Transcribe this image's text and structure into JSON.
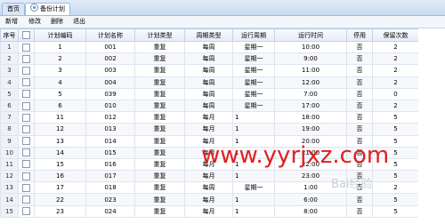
{
  "tabs": [
    {
      "label": "首页"
    },
    {
      "label": "备份计划"
    }
  ],
  "toolbar": {
    "add": "新增",
    "edit": "修改",
    "delete": "删除",
    "exit": "退出"
  },
  "columns": {
    "rownum": "序号",
    "code": "计划编码",
    "name": "计划名称",
    "type": "计划类型",
    "cycle_type": "周期类型",
    "cycle": "运行周期",
    "time": "运行时间",
    "disabled": "停用",
    "keep": "保留次数"
  },
  "rows": [
    {
      "n": "1",
      "code": "1",
      "name": "001",
      "type": "重复",
      "cycle_type": "每周",
      "cycle": "星期一",
      "time": "10:00",
      "disabled": "否",
      "keep": "2"
    },
    {
      "n": "2",
      "code": "2",
      "name": "002",
      "type": "重复",
      "cycle_type": "每周",
      "cycle": "星期一",
      "time": "9:00",
      "disabled": "否",
      "keep": "2"
    },
    {
      "n": "3",
      "code": "3",
      "name": "003",
      "type": "重复",
      "cycle_type": "每周",
      "cycle": "星期一",
      "time": "11:00",
      "disabled": "否",
      "keep": "2"
    },
    {
      "n": "4",
      "code": "4",
      "name": "004",
      "type": "重复",
      "cycle_type": "每周",
      "cycle": "星期一",
      "time": "12:00",
      "disabled": "否",
      "keep": "2"
    },
    {
      "n": "5",
      "code": "5",
      "name": "039",
      "type": "重复",
      "cycle_type": "每周",
      "cycle": "星期一",
      "time": "7:00",
      "disabled": "否",
      "keep": "0"
    },
    {
      "n": "6",
      "code": "6",
      "name": "010",
      "type": "重复",
      "cycle_type": "每周",
      "cycle": "星期一",
      "time": "17:00",
      "disabled": "否",
      "keep": "2"
    },
    {
      "n": "7",
      "code": "11",
      "name": "012",
      "type": "重复",
      "cycle_type": "每月",
      "cycle": "1",
      "time": "18:00",
      "disabled": "否",
      "keep": "5"
    },
    {
      "n": "8",
      "code": "12",
      "name": "013",
      "type": "重复",
      "cycle_type": "每月",
      "cycle": "1",
      "time": "19:00",
      "disabled": "否",
      "keep": "5"
    },
    {
      "n": "9",
      "code": "13",
      "name": "014",
      "type": "重复",
      "cycle_type": "每月",
      "cycle": "1",
      "time": "20:00",
      "disabled": "否",
      "keep": "5"
    },
    {
      "n": "10",
      "code": "14",
      "name": "015",
      "type": "重复",
      "cycle_type": "每月",
      "cycle": "1",
      "time": "21:00",
      "disabled": "否",
      "keep": "5"
    },
    {
      "n": "11",
      "code": "15",
      "name": "016",
      "type": "重复",
      "cycle_type": "每月",
      "cycle": "1",
      "time": "22:00",
      "disabled": "否",
      "keep": "5"
    },
    {
      "n": "12",
      "code": "16",
      "name": "017",
      "type": "重复",
      "cycle_type": "每月",
      "cycle": "1",
      "time": "23:00",
      "disabled": "否",
      "keep": "5"
    },
    {
      "n": "13",
      "code": "17",
      "name": "018",
      "type": "重复",
      "cycle_type": "每周",
      "cycle": "星期一",
      "time": "1:00",
      "disabled": "否",
      "keep": "2"
    },
    {
      "n": "14",
      "code": "22",
      "name": "023",
      "type": "重复",
      "cycle_type": "每月",
      "cycle": "1",
      "time": "6:00",
      "disabled": "否",
      "keep": "5"
    },
    {
      "n": "15",
      "code": "23",
      "name": "024",
      "type": "重复",
      "cycle_type": "每月",
      "cycle": "1",
      "time": "8:00",
      "disabled": "否",
      "keep": "5"
    }
  ],
  "watermark": "www.yyrjxz.com",
  "baidu_watermark": "Bai经验"
}
